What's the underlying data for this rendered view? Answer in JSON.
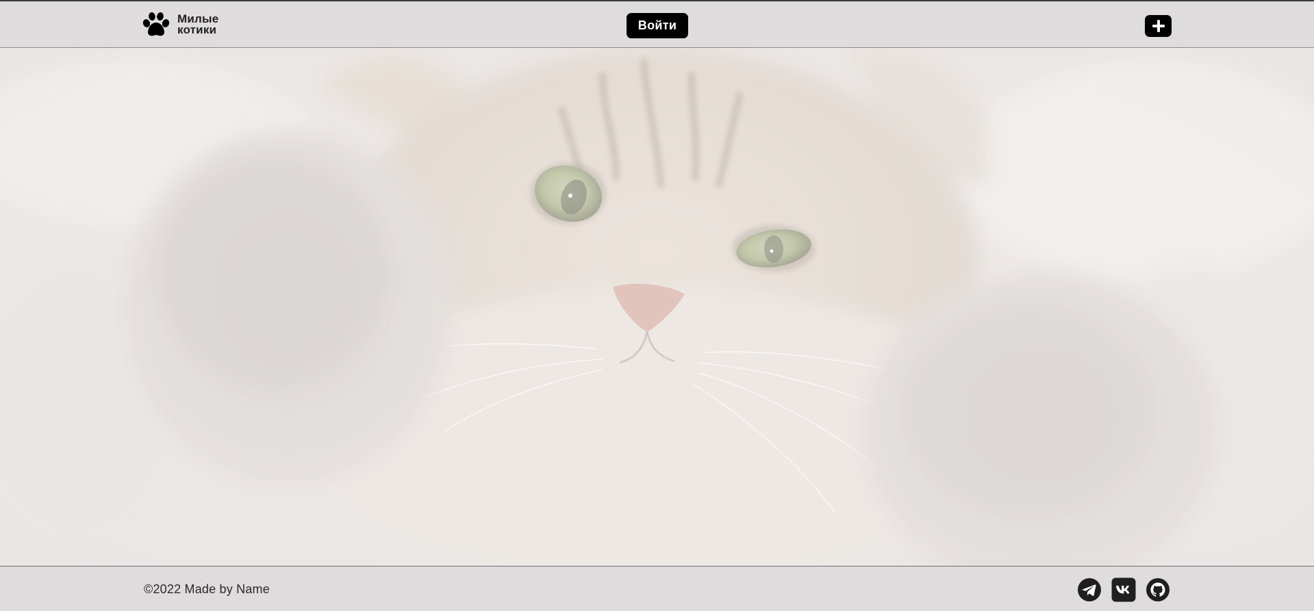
{
  "header": {
    "logo": {
      "line1": "Милые",
      "line2": "котики",
      "icon": "paw-icon"
    },
    "login_label": "Войти",
    "add_icon": "plus-icon"
  },
  "hero": {
    "image": "cat-photo"
  },
  "footer": {
    "copyright": "©2022 Made by Name",
    "social": [
      {
        "name": "telegram",
        "icon": "telegram-icon"
      },
      {
        "name": "vk",
        "icon": "vk-icon"
      },
      {
        "name": "github",
        "icon": "github-icon"
      }
    ]
  },
  "colors": {
    "bar_background": "#dedcdd",
    "button_background": "#000000",
    "button_text": "#ffffff",
    "text_dark": "#1f1f1f"
  }
}
